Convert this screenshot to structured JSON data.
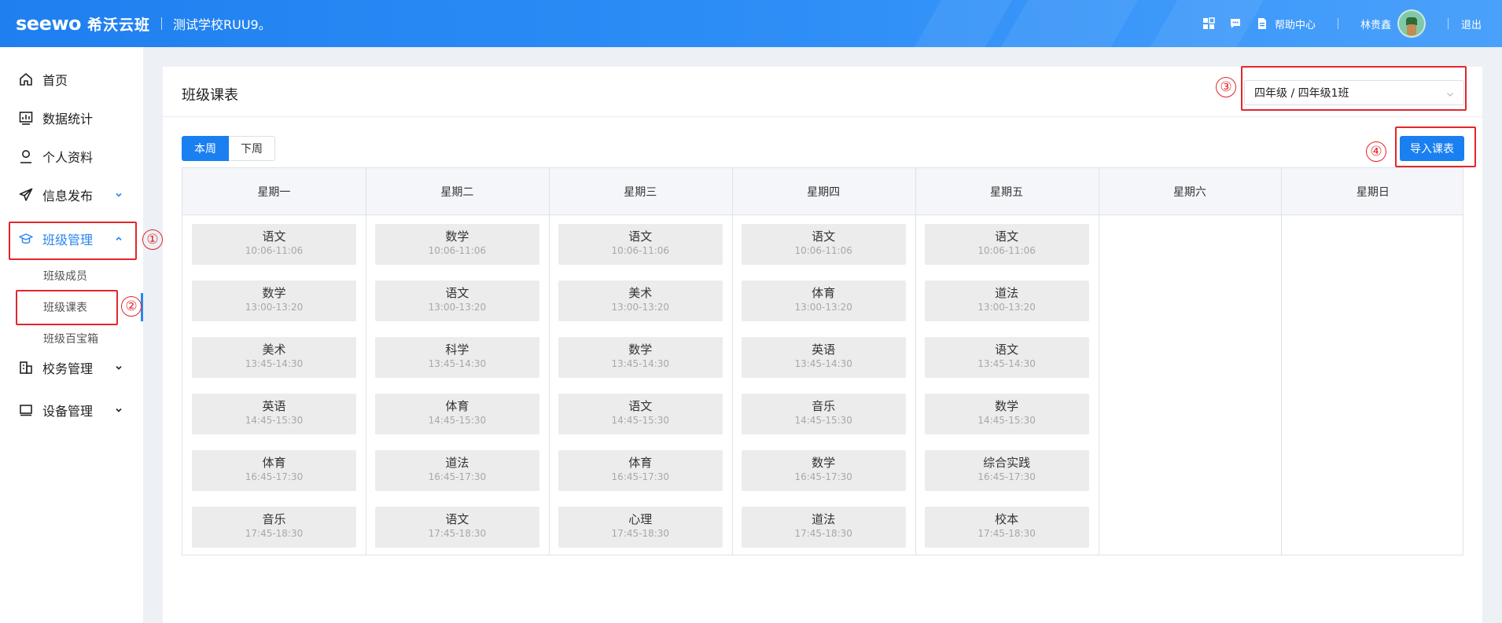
{
  "header": {
    "logo": "seewo",
    "logo_cn": "希沃云班",
    "school": "测试学校RUU9。",
    "help": "帮助中心",
    "user": "林贵鑫",
    "logout": "退出"
  },
  "sidebar": {
    "items": [
      {
        "label": "首页",
        "icon": "home-icon"
      },
      {
        "label": "数据统计",
        "icon": "chart-icon"
      },
      {
        "label": "个人资料",
        "icon": "user-icon"
      },
      {
        "label": "信息发布",
        "icon": "send-icon"
      },
      {
        "label": "班级管理",
        "icon": "graduation-cap-icon"
      },
      {
        "label": "校务管理",
        "icon": "building-icon"
      },
      {
        "label": "设备管理",
        "icon": "monitor-icon"
      }
    ],
    "sub_items": [
      "班级成员",
      "班级课表",
      "班级百宝箱"
    ]
  },
  "annotations": [
    "①",
    "②",
    "③",
    "④"
  ],
  "page": {
    "title": "班级课表",
    "class_select": "四年级 / 四年级1班",
    "this_week": "本周",
    "next_week": "下周",
    "import_button": "导入课表"
  },
  "timetable": {
    "days": [
      "星期一",
      "星期二",
      "星期三",
      "星期四",
      "星期五",
      "星期六",
      "星期日"
    ],
    "columns": [
      [
        {
          "subject": "语文",
          "time": "10:06-11:06"
        },
        {
          "subject": "数学",
          "time": "13:00-13:20"
        },
        {
          "subject": "美术",
          "time": "13:45-14:30"
        },
        {
          "subject": "英语",
          "time": "14:45-15:30"
        },
        {
          "subject": "体育",
          "time": "16:45-17:30"
        },
        {
          "subject": "音乐",
          "time": "17:45-18:30"
        }
      ],
      [
        {
          "subject": "数学",
          "time": "10:06-11:06"
        },
        {
          "subject": "语文",
          "time": "13:00-13:20"
        },
        {
          "subject": "科学",
          "time": "13:45-14:30"
        },
        {
          "subject": "体育",
          "time": "14:45-15:30"
        },
        {
          "subject": "道法",
          "time": "16:45-17:30"
        },
        {
          "subject": "语文",
          "time": "17:45-18:30"
        }
      ],
      [
        {
          "subject": "语文",
          "time": "10:06-11:06"
        },
        {
          "subject": "美术",
          "time": "13:00-13:20"
        },
        {
          "subject": "数学",
          "time": "13:45-14:30"
        },
        {
          "subject": "语文",
          "time": "14:45-15:30"
        },
        {
          "subject": "体育",
          "time": "16:45-17:30"
        },
        {
          "subject": "心理",
          "time": "17:45-18:30"
        }
      ],
      [
        {
          "subject": "语文",
          "time": "10:06-11:06"
        },
        {
          "subject": "体育",
          "time": "13:00-13:20"
        },
        {
          "subject": "英语",
          "time": "13:45-14:30"
        },
        {
          "subject": "音乐",
          "time": "14:45-15:30"
        },
        {
          "subject": "数学",
          "time": "16:45-17:30"
        },
        {
          "subject": "道法",
          "time": "17:45-18:30"
        }
      ],
      [
        {
          "subject": "语文",
          "time": "10:06-11:06"
        },
        {
          "subject": "道法",
          "time": "13:00-13:20"
        },
        {
          "subject": "语文",
          "time": "13:45-14:30"
        },
        {
          "subject": "数学",
          "time": "14:45-15:30"
        },
        {
          "subject": "综合实践",
          "time": "16:45-17:30"
        },
        {
          "subject": "校本",
          "time": "17:45-18:30"
        }
      ],
      [],
      []
    ]
  },
  "colors": {
    "primary": "#1a7ff1",
    "annotation": "#e3262c"
  }
}
